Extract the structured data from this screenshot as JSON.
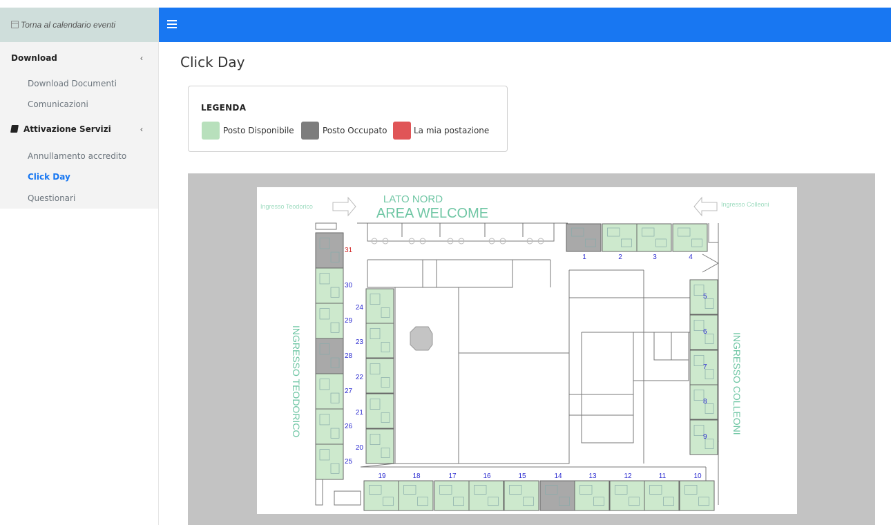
{
  "sidebar": {
    "back_label": "Torna al calendario eventi",
    "sections": [
      {
        "label": "Download",
        "chevron": "‹",
        "items": [
          {
            "label": "Download Documenti",
            "active": false
          },
          {
            "label": "Comunicazioni",
            "active": false
          }
        ]
      },
      {
        "label": "Attivazione Servizi",
        "chevron": "‹",
        "items": [
          {
            "label": "Annullamento accredito",
            "active": false
          },
          {
            "label": "Click Day",
            "active": true
          },
          {
            "label": "Questionari",
            "active": false
          }
        ]
      }
    ]
  },
  "page": {
    "title": "Click Day"
  },
  "legend": {
    "title": "LEGENDA",
    "items": [
      {
        "label": "Posto Disponibile",
        "color": "#b8e0bc"
      },
      {
        "label": "Posto Occupato",
        "color": "#7d7d7d"
      },
      {
        "label": "La mia postazione",
        "color": "#e05557"
      }
    ]
  },
  "map": {
    "north_label": "LATO NORD",
    "welcome_label": "AREA WELCOME",
    "entrance_left_small": "Ingresso Teodorico",
    "entrance_right_small": "Ingresso Colleoni",
    "entrance_left_big": "INGRESSO TEODORICO",
    "entrance_right_big": "INGRESSO COLLEONI",
    "colors": {
      "available": "#cde9cd",
      "occupied": "#a9a9a9",
      "mine": "#e05557",
      "label_blue": "#2a2ad0",
      "label_red": "#d02020",
      "entrance_text": "#6fc6a4"
    },
    "desks": [
      {
        "n": "1",
        "status": "occupied"
      },
      {
        "n": "2",
        "status": "available"
      },
      {
        "n": "3",
        "status": "available"
      },
      {
        "n": "4",
        "status": "available"
      },
      {
        "n": "5",
        "status": "available"
      },
      {
        "n": "6",
        "status": "available"
      },
      {
        "n": "7",
        "status": "available"
      },
      {
        "n": "8",
        "status": "available"
      },
      {
        "n": "9",
        "status": "available"
      },
      {
        "n": "10",
        "status": "available"
      },
      {
        "n": "11",
        "status": "available"
      },
      {
        "n": "12",
        "status": "available"
      },
      {
        "n": "13",
        "status": "available"
      },
      {
        "n": "14",
        "status": "occupied"
      },
      {
        "n": "15",
        "status": "available"
      },
      {
        "n": "16",
        "status": "available"
      },
      {
        "n": "17",
        "status": "available"
      },
      {
        "n": "18",
        "status": "available"
      },
      {
        "n": "19",
        "status": "available"
      },
      {
        "n": "20",
        "status": "available"
      },
      {
        "n": "21",
        "status": "available"
      },
      {
        "n": "22",
        "status": "available"
      },
      {
        "n": "23",
        "status": "available"
      },
      {
        "n": "24",
        "status": "available"
      },
      {
        "n": "25",
        "status": "available"
      },
      {
        "n": "26",
        "status": "available"
      },
      {
        "n": "27",
        "status": "available"
      },
      {
        "n": "28",
        "status": "occupied"
      },
      {
        "n": "29",
        "status": "available"
      },
      {
        "n": "30",
        "status": "available"
      },
      {
        "n": "31",
        "status": "occupied"
      }
    ]
  }
}
